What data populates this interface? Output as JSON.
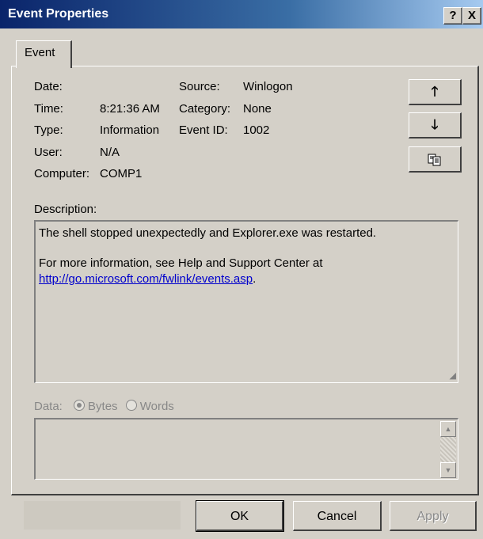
{
  "window": {
    "title": "Event Properties",
    "help_label": "?",
    "close_label": "X"
  },
  "tabs": [
    {
      "label": "Event",
      "active": true
    }
  ],
  "fields": {
    "date": {
      "label": "Date:",
      "value": ""
    },
    "time": {
      "label": "Time:",
      "value": "8:21:36 AM"
    },
    "type": {
      "label": "Type:",
      "value": "Information"
    },
    "user": {
      "label": "User:",
      "value": "N/A"
    },
    "computer": {
      "label": "Computer:",
      "value": "COMP1"
    },
    "source": {
      "label": "Source:",
      "value": "Winlogon"
    },
    "category": {
      "label": "Category:",
      "value": "None"
    },
    "event_id": {
      "label": "Event ID:",
      "value": "1002"
    }
  },
  "nav": {
    "up_icon": "arrow-up-icon",
    "down_icon": "arrow-down-icon",
    "copy_icon": "copy-icon"
  },
  "description": {
    "label": "Description:",
    "line1": "The shell stopped unexpectedly and Explorer.exe was restarted.",
    "line2": "For more information, see Help and Support Center at",
    "link": "http://go.microsoft.com/fwlink/events.asp",
    "link_suffix": "."
  },
  "data_section": {
    "label": "Data:",
    "options": [
      {
        "label": "Bytes",
        "selected": true
      },
      {
        "label": "Words",
        "selected": false
      }
    ],
    "enabled": false
  },
  "buttons": {
    "ok": "OK",
    "cancel": "Cancel",
    "apply": "Apply"
  },
  "colors": {
    "titlebar_start": "#0a246a",
    "titlebar_end": "#a6caf0",
    "face": "#d4d0c8",
    "link": "#0000cc"
  }
}
